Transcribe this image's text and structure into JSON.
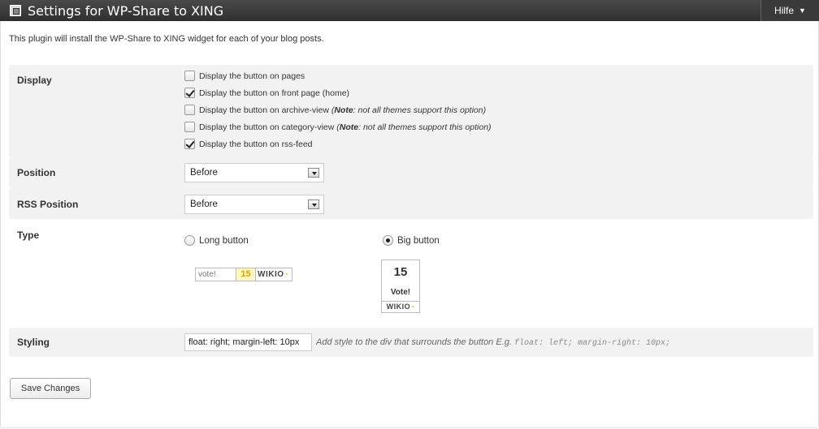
{
  "header": {
    "title": "Settings for WP-Share to XING",
    "help_label": "Hilfe",
    "help_arrow": "▼"
  },
  "intro": "This plugin will install the WP-Share to XING widget for each of your blog posts.",
  "display": {
    "label": "Display",
    "options": [
      {
        "label": "Display the button on pages",
        "checked": false
      },
      {
        "label": "Display the button on front page (home)",
        "checked": true
      },
      {
        "label": "Display the button on archive-view",
        "checked": false,
        "note_bold": "Note",
        "note_rest": ": not all themes support this option"
      },
      {
        "label": "Display the button on category-view",
        "checked": false,
        "note_bold": "Note",
        "note_rest": ": not all themes support this option"
      },
      {
        "label": "Display the button on rss-feed",
        "checked": true
      }
    ]
  },
  "position": {
    "label": "Position",
    "value": "Before"
  },
  "rss_position": {
    "label": "RSS Position",
    "value": "Before"
  },
  "type": {
    "label": "Type",
    "long_label": "Long button",
    "big_label": "Big button",
    "selected": "big",
    "long_preview": {
      "vote": "vote!",
      "count": "15",
      "brand": "WIKIO"
    },
    "big_preview": {
      "count": "15",
      "vote": "Vote!",
      "brand": "WIKIO"
    }
  },
  "styling": {
    "label": "Styling",
    "value": "float: right; margin-left: 10px",
    "help_text": "Add style to the div that surrounds the button E.g.",
    "help_example": "float: left; margin-right: 10px;"
  },
  "save_label": "Save Changes"
}
